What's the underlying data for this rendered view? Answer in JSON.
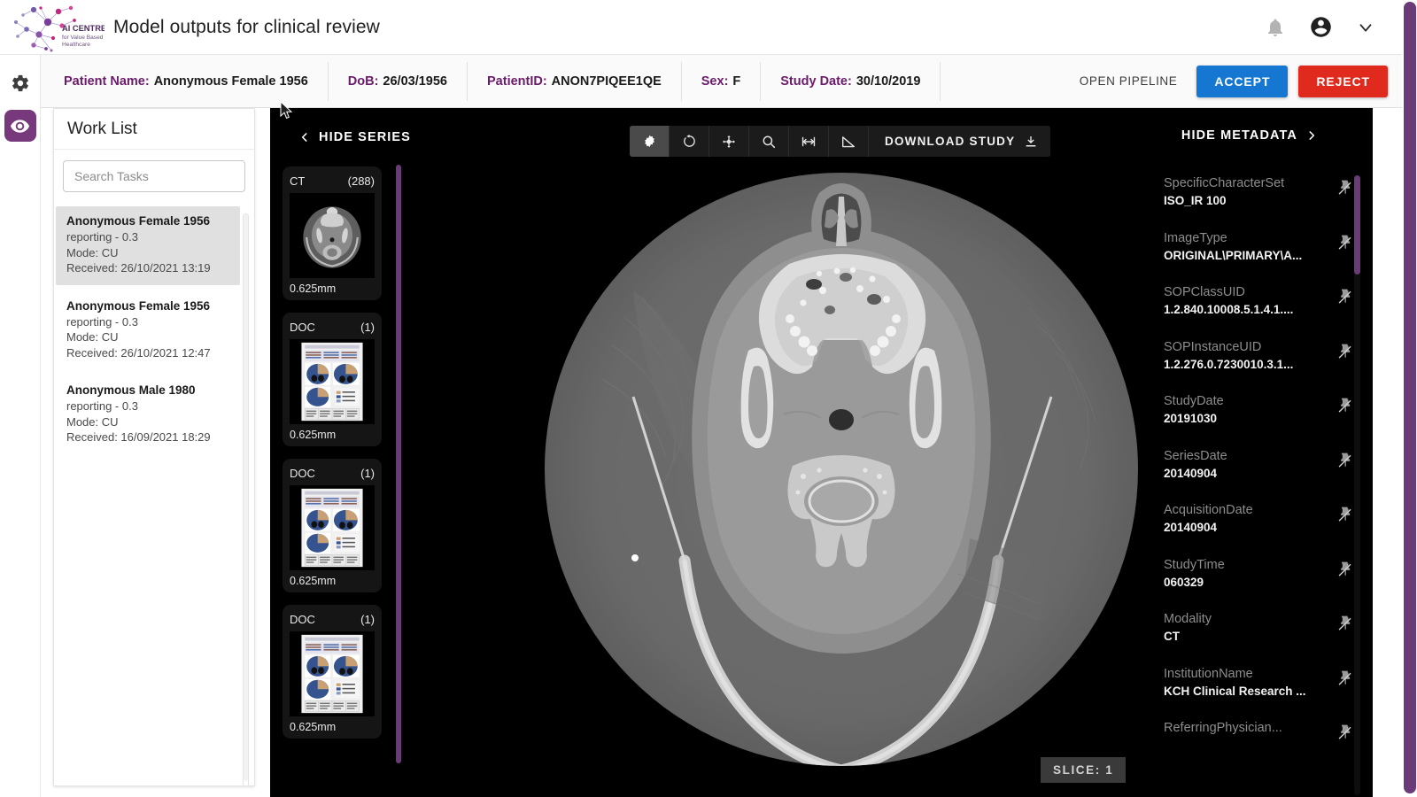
{
  "header": {
    "title": "Model outputs for clinical review",
    "logo": {
      "name": "AI CENTRE",
      "line2": "for Value Based",
      "line3": "Healthcare",
      "colors": [
        "#7b3f98",
        "#c0277f",
        "#9b5fb5",
        "#5e4b9e"
      ]
    },
    "icons": [
      {
        "name": "notifications-bell-icon",
        "label": "Notifications"
      },
      {
        "name": "account-circle-icon",
        "label": "Account"
      },
      {
        "name": "chevron-down-icon",
        "label": "Account menu"
      }
    ]
  },
  "rail": {
    "items": [
      {
        "name": "settings-gear-icon",
        "label": "Settings",
        "active": false
      },
      {
        "name": "viewer-eye-icon",
        "label": "Viewer",
        "active": true
      }
    ],
    "active_color": "#77397c"
  },
  "patient_bar": {
    "fields": [
      {
        "label": "Patient Name:",
        "value": "Anonymous Female 1956"
      },
      {
        "label": "DoB:",
        "value": "26/03/1956"
      },
      {
        "label": "PatientID:",
        "value": "ANON7PIQEE1QE"
      },
      {
        "label": "Sex:",
        "value": "F"
      },
      {
        "label": "Study Date:",
        "value": "30/10/2019"
      }
    ],
    "open_pipeline_label": "OPEN PIPELINE",
    "accept_label": "ACCEPT",
    "reject_label": "REJECT",
    "accept_color": "#1577d2",
    "reject_color": "#e02a1e",
    "label_color": "#6a1b6a"
  },
  "worklist": {
    "title": "Work List",
    "search_placeholder": "Search Tasks",
    "search_value": "",
    "items": [
      {
        "name": "Anonymous Female 1956",
        "status": "reporting - 0.3",
        "mode": "Mode: CU",
        "received": "Received: 26/10/2021 13:19",
        "selected": true
      },
      {
        "name": "Anonymous Female 1956",
        "status": "reporting - 0.3",
        "mode": "Mode: CU",
        "received": "Received: 26/10/2021 12:47",
        "selected": false
      },
      {
        "name": "Anonymous Male 1980",
        "status": "reporting - 0.3",
        "mode": "Mode: CU",
        "received": "Received: 16/09/2021 18:29",
        "selected": false
      }
    ]
  },
  "viewer": {
    "hide_series_label": "HIDE SERIES",
    "hide_metadata_label": "HIDE METADATA",
    "download_label": "DOWNLOAD STUDY",
    "slice_label": "SLICE: 1",
    "accent_color": "#6a3a79",
    "tools": [
      {
        "name": "windowing-levels-icon",
        "label": "Window / Level",
        "active": true
      },
      {
        "name": "rotate-icon",
        "label": "Rotate",
        "active": false
      },
      {
        "name": "pan-move-icon",
        "label": "Pan",
        "active": false
      },
      {
        "name": "zoom-magnifier-icon",
        "label": "Zoom",
        "active": false
      },
      {
        "name": "length-measure-icon",
        "label": "Length",
        "active": false
      },
      {
        "name": "angle-measure-icon",
        "label": "Angle",
        "active": false
      }
    ],
    "series": [
      {
        "modality": "CT",
        "count": "(288)",
        "thickness": "0.625mm",
        "kind": "ct"
      },
      {
        "modality": "DOC",
        "count": "(1)",
        "thickness": "0.625mm",
        "kind": "doc"
      },
      {
        "modality": "DOC",
        "count": "(1)",
        "thickness": "0.625mm",
        "kind": "doc"
      },
      {
        "modality": "DOC",
        "count": "(1)",
        "thickness": "0.625mm",
        "kind": "doc"
      }
    ]
  },
  "metadata": {
    "pin_icon_name": "pin-off-icon",
    "rows": [
      {
        "key": "SpecificCharacterSet",
        "value": "ISO_IR 100"
      },
      {
        "key": "ImageType",
        "value": "ORIGINAL\\PRIMARY\\A..."
      },
      {
        "key": "SOPClassUID",
        "value": "1.2.840.10008.5.1.4.1...."
      },
      {
        "key": "SOPInstanceUID",
        "value": "1.2.276.0.7230010.3.1..."
      },
      {
        "key": "StudyDate",
        "value": "20191030"
      },
      {
        "key": "SeriesDate",
        "value": "20140904"
      },
      {
        "key": "AcquisitionDate",
        "value": "20140904"
      },
      {
        "key": "StudyTime",
        "value": "060329"
      },
      {
        "key": "Modality",
        "value": "CT"
      },
      {
        "key": "InstitutionName",
        "value": "KCH Clinical Research ..."
      },
      {
        "key": "ReferringPhysician...",
        "value": ""
      }
    ]
  }
}
